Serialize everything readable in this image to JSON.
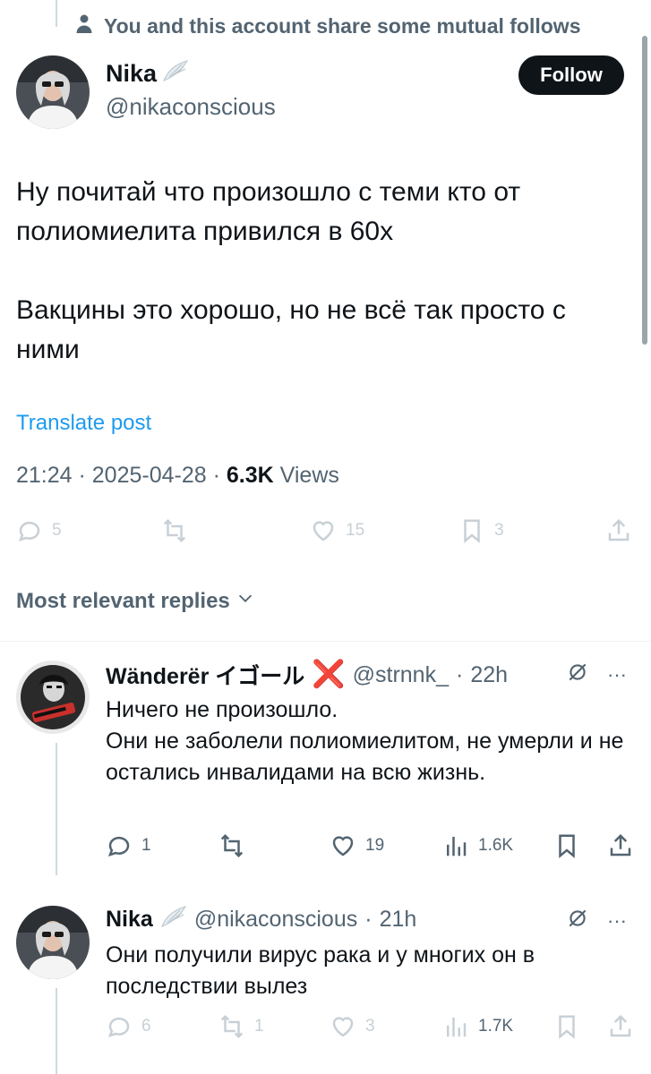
{
  "context": {
    "text": "You and this account share some mutual follows"
  },
  "post": {
    "author_name": "Nika",
    "author_handle": "@nikaconscious",
    "follow_label": "Follow",
    "text_1": "Ну почитай что произошло с теми кто от полиомиелита привился в 60х",
    "text_2": "Вакцины это хорошо, но не всё так просто с ними",
    "translate_label": "Translate post",
    "time": "21:24",
    "date": "2025-04-28",
    "views_count": "6.3K",
    "views_label": "Views",
    "stats": {
      "replies": "5",
      "reposts": "",
      "likes": "15",
      "bookmarks": "3"
    }
  },
  "replies_header": {
    "label": "Most relevant replies"
  },
  "replies": [
    {
      "name": "Wänderër イゴール",
      "badge": "❌",
      "handle": "@strnnk_",
      "time": "22h",
      "text": "Ничего не произошло.\nОни не заболели полиомиелитом, не умерли и не остались инвалидами на всю жизнь.",
      "stats": {
        "replies": "1",
        "reposts": "",
        "likes": "19",
        "views": "1.6K"
      }
    },
    {
      "name": "Nika",
      "handle": "@nikaconscious",
      "time": "21h",
      "text": "Они получили вирус рака и у многих он в последствии вылез",
      "stats": {
        "replies": "6",
        "reposts": "1",
        "likes": "3",
        "views": "1.7K"
      }
    }
  ],
  "colors": {
    "accent": "#1d9bf0",
    "secondary_text": "#536471",
    "primary_text": "#0f1419",
    "badge": "#e0245e"
  }
}
